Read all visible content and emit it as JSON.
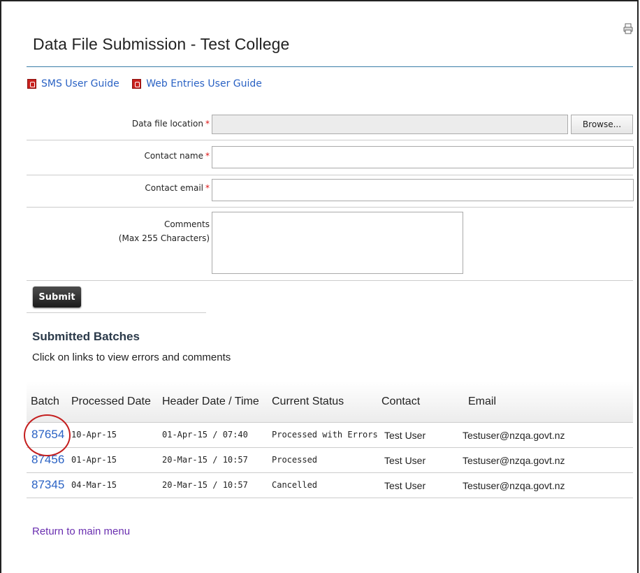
{
  "page": {
    "title": "Data File Submission - Test College"
  },
  "guides": [
    {
      "label": "SMS User Guide",
      "icon": "pdf-icon"
    },
    {
      "label": "Web Entries User Guide",
      "icon": "pdf-icon"
    }
  ],
  "form": {
    "data_file_label": "Data file location",
    "contact_name_label": "Contact name",
    "contact_email_label": "Contact email",
    "comments_label": "Comments",
    "comments_hint": "(Max 255 Characters)",
    "required_mark": "*",
    "browse_label": "Browse...",
    "data_file_value": "",
    "contact_name_value": "",
    "contact_email_value": "",
    "comments_value": "",
    "submit_label": "Submit"
  },
  "batches": {
    "title": "Submitted Batches",
    "subtitle": "Click on links to view errors and comments",
    "columns": [
      "Batch",
      "Processed Date",
      "Header Date / Time",
      "Current Status",
      "Contact",
      "Email"
    ],
    "rows": [
      {
        "batch": "87654",
        "processed": "10-Apr-15",
        "header": "01-Apr-15 / 07:40",
        "status": "Processed with Errors",
        "contact": "Test User",
        "email": "Testuser@nzqa.govt.nz"
      },
      {
        "batch": "87456",
        "processed": "01-Apr-15",
        "header": "20-Mar-15 / 10:57",
        "status": "Processed",
        "contact": "Test User",
        "email": "Testuser@nzqa.govt.nz"
      },
      {
        "batch": "87345",
        "processed": "04-Mar-15",
        "header": "20-Mar-15 / 10:57",
        "status": "Cancelled",
        "contact": "Test User",
        "email": "Testuser@nzqa.govt.nz"
      }
    ]
  },
  "footer": {
    "return_link": "Return to main menu"
  },
  "colors": {
    "link": "#2a62c4",
    "visited_link": "#6a2fb0",
    "required": "#dd1111",
    "highlight_circle": "#c41e1e",
    "title_rule": "#3a7ea8"
  }
}
